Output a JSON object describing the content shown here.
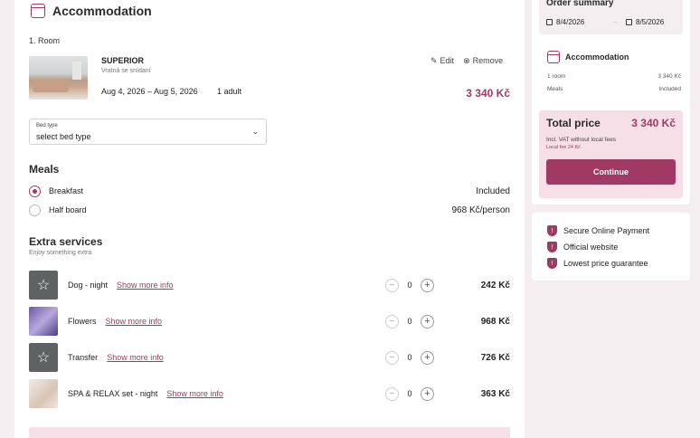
{
  "accommodation": {
    "title": "Accommodation",
    "room_number": "1. Room",
    "room": {
      "name": "SUPERIOR",
      "subtitle": "Vratná se snídaní",
      "dates": "Aug 4, 2026 – Aug 5, 2026",
      "guests": "1 adult",
      "price": "3 340 Kč",
      "edit_label": "Edit",
      "remove_label": "Remove"
    },
    "bed_type": {
      "label": "Bed type",
      "value": "select bed type"
    }
  },
  "meals": {
    "title": "Meals",
    "options": [
      {
        "name": "Breakfast",
        "value": "Included",
        "selected": true
      },
      {
        "name": "Half board",
        "value": "968 Kč/person",
        "selected": false
      }
    ]
  },
  "extras": {
    "title": "Extra services",
    "subtitle": "Enjoy something extra",
    "more_label": "Show more info",
    "items": [
      {
        "name": "Dog - night",
        "qty": "0",
        "price": "242 Kč",
        "icon": "star-icon"
      },
      {
        "name": "Flowers",
        "qty": "0",
        "price": "968 Kč",
        "icon": "flowers-photo"
      },
      {
        "name": "Transfer",
        "qty": "0",
        "price": "726 Kč",
        "icon": "star-icon"
      },
      {
        "name": "SPA & RELAX set - night",
        "qty": "0",
        "price": "363 Kč",
        "icon": "spa-photo"
      }
    ]
  },
  "summary": {
    "title": "Order summary",
    "date_from": "8/4/2026",
    "date_to": "8/5/2026",
    "accommodation_label": "Accommodation",
    "rows": [
      {
        "label": "1 room",
        "value": "3 340 Kč"
      },
      {
        "label": "Meals",
        "value": "Included"
      }
    ],
    "total_label": "Total price",
    "total_value": "3 340 Kč",
    "vat_note": "Incl. VAT without local fees",
    "local_fee": "Local fee 24 Kč",
    "continue_label": "Continue"
  },
  "trust": [
    {
      "label": "Secure Online Payment"
    },
    {
      "label": "Official website"
    },
    {
      "label": "Lowest price guarantee"
    }
  ],
  "colors": {
    "accent": "#a03a64",
    "accent_light": "#f6dfe7",
    "background": "#f4eef1"
  }
}
